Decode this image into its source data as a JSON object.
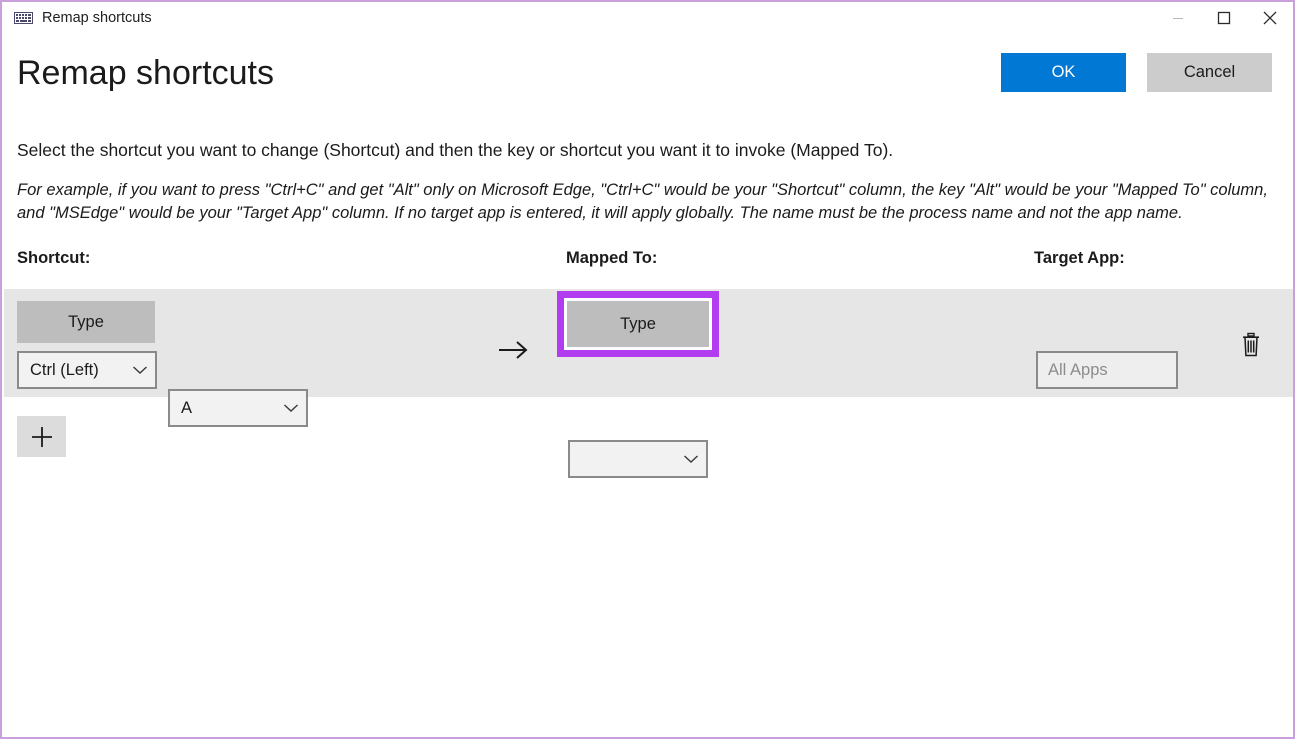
{
  "window": {
    "title": "Remap shortcuts",
    "icon": "keyboard-icon",
    "border_color": "#c9a0dc",
    "controls": {
      "minimize": "minimize-icon",
      "maximize": "maximize-icon",
      "close": "close-icon"
    }
  },
  "header": {
    "page_title": "Remap shortcuts",
    "ok_label": "OK",
    "cancel_label": "Cancel",
    "ok_color": "#0078d4",
    "cancel_color": "#cccccc"
  },
  "description": {
    "main": "Select the shortcut you want to change (Shortcut) and then the key or shortcut you want it to invoke (Mapped To).",
    "example": "For example, if you want to press \"Ctrl+C\" and get \"Alt\" only on Microsoft Edge, \"Ctrl+C\" would be your \"Shortcut\" column, the key \"Alt\" would be your \"Mapped To\" column, and \"MSEdge\" would be your \"Target App\" column. If no target app is entered, it will apply globally. The name must be the process name and not the app name."
  },
  "columns": {
    "shortcut": "Shortcut:",
    "mapped_to": "Mapped To:",
    "target_app": "Target App:"
  },
  "row": {
    "shortcut": {
      "type_label": "Type",
      "key1": "Ctrl (Left)",
      "key2": "A"
    },
    "arrow": "arrow-right-icon",
    "mapped_to": {
      "type_label": "Type",
      "key1": "",
      "highlight_color": "#b23cf0",
      "highlighted": true
    },
    "target_app": {
      "value": "",
      "placeholder": "All Apps"
    },
    "delete_icon": "trash-icon"
  },
  "add_row": {
    "icon": "plus-icon"
  }
}
